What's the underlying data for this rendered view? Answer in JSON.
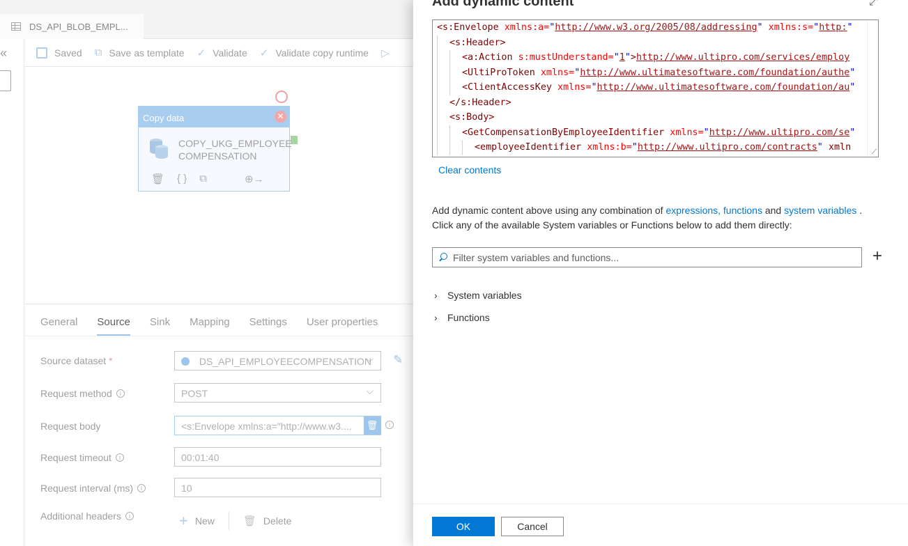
{
  "document_tab": {
    "label": "DS_API_BLOB_EMPL..."
  },
  "toolbar": {
    "saved": "Saved",
    "save_as_template": "Save as template",
    "validate": "Validate",
    "validate_copy_runtime": "Validate copy runtime"
  },
  "activity": {
    "type": "Copy data",
    "name_line1": "COPY_UKG_EMPLOYEE",
    "name_line2": "COMPENSATION"
  },
  "props_tabs": [
    "General",
    "Source",
    "Sink",
    "Mapping",
    "Settings",
    "User properties"
  ],
  "props_active_tab": "Source",
  "source": {
    "dataset_label": "Source dataset",
    "dataset_required": "*",
    "dataset_value": "DS_API_EMPLOYEECOMPENSATION",
    "method_label": "Request method",
    "method_value": "POST",
    "body_label": "Request body",
    "body_value": "<s:Envelope xmlns:a=\"http://www.w3....",
    "timeout_label": "Request timeout",
    "timeout_value": "00:01:40",
    "interval_label": "Request interval (ms)",
    "interval_value": "10",
    "headers_label": "Additional headers",
    "new_label": "New",
    "delete_label": "Delete"
  },
  "panel": {
    "title": "Add dynamic content",
    "clear_contents": "Clear contents",
    "help_pre": "Add dynamic content above using any combination of ",
    "help_link1": "expressions, functions",
    "help_mid": " and ",
    "help_link2": "system variables",
    "help_post": " .",
    "help_line2": "Click any of the available System variables or Functions below to add them directly:",
    "filter_placeholder": "Filter system variables and functions...",
    "tree": [
      "System variables",
      "Functions"
    ],
    "ok": "OK",
    "cancel": "Cancel"
  },
  "code": [
    {
      "indent": 0,
      "tag": "<s:Envelope",
      "attrs": [
        {
          "n": " xmlns:a=",
          "v": "http://www.w3.org/2005/08/addressing"
        },
        {
          "n": " xmlns:s=",
          "v": "http:"
        }
      ],
      "tail": ""
    },
    {
      "indent": 1,
      "tag": "<s:Header>",
      "attrs": [],
      "tail": ""
    },
    {
      "indent": 2,
      "tag": "<a:Action",
      "attrs": [
        {
          "n": " s:mustUnderstand=",
          "v": "1"
        }
      ],
      "tail": ">",
      "text": "http://www.ultipro.com/services/employ"
    },
    {
      "indent": 2,
      "tag": "<UltiProToken",
      "attrs": [
        {
          "n": " xmlns=",
          "v": "http://www.ultimatesoftware.com/foundation/authe"
        }
      ],
      "tail": ""
    },
    {
      "indent": 2,
      "tag": "<ClientAccessKey",
      "attrs": [
        {
          "n": " xmlns=",
          "v": "http://www.ultimatesoftware.com/foundation/au"
        }
      ],
      "tail": ""
    },
    {
      "indent": 1,
      "tag": "</s:Header>",
      "attrs": [],
      "tail": ""
    },
    {
      "indent": 1,
      "tag": "<s:Body>",
      "attrs": [],
      "tail": ""
    },
    {
      "indent": 2,
      "tag": "<GetCompensationByEmployeeIdentifier",
      "attrs": [
        {
          "n": " xmlns=",
          "v": "http://www.ultipro.com/se"
        }
      ],
      "tail": ""
    },
    {
      "indent": 3,
      "tag": "<employeeIdentifier",
      "attrs": [
        {
          "n": " xmlns:b=",
          "v": "http://www.ultipro.com/contracts"
        }
      ],
      "tail": " xmln"
    }
  ]
}
